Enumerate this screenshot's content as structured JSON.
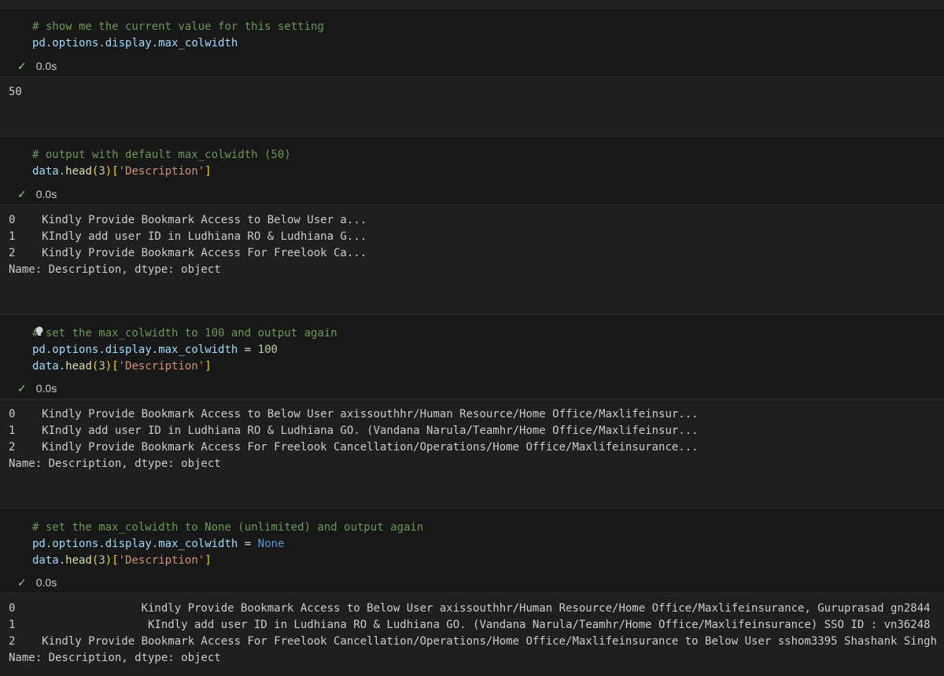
{
  "cells": [
    {
      "code": [
        [
          [
            "comment",
            "# show me the current value for this setting"
          ]
        ],
        [
          [
            "ident",
            "pd"
          ],
          [
            "punct",
            "."
          ],
          [
            "ident",
            "options"
          ],
          [
            "punct",
            "."
          ],
          [
            "ident",
            "display"
          ],
          [
            "punct",
            "."
          ],
          [
            "ident",
            "max_colwidth"
          ]
        ]
      ],
      "status": {
        "icon": "check-icon",
        "time": "0.0s"
      },
      "output": [
        "50"
      ]
    },
    {
      "code": [
        [
          [
            "comment",
            "# output with default max_colwidth (50)"
          ]
        ],
        [
          [
            "ident",
            "data"
          ],
          [
            "punct",
            "."
          ],
          [
            "func",
            "head"
          ],
          [
            "bracket",
            "("
          ],
          [
            "number",
            "3"
          ],
          [
            "bracket",
            ")"
          ],
          [
            "bracket",
            "["
          ],
          [
            "string",
            "'Description'"
          ],
          [
            "bracket",
            "]"
          ]
        ]
      ],
      "status": {
        "icon": "check-icon",
        "time": "0.0s"
      },
      "output": [
        "0    Kindly Provide Bookmark Access to Below User a...",
        "1    KIndly add user ID in Ludhiana RO & Ludhiana G...",
        "2    Kindly Provide Bookmark Access For Freelook Ca...",
        "Name: Description, dtype: object"
      ]
    },
    {
      "code": [
        [
          [
            "comment",
            "# set the max_colwidth to 100 and output again"
          ]
        ],
        [
          [
            "ident",
            "pd"
          ],
          [
            "punct",
            "."
          ],
          [
            "ident",
            "options"
          ],
          [
            "punct",
            "."
          ],
          [
            "ident",
            "display"
          ],
          [
            "punct",
            "."
          ],
          [
            "ident",
            "max_colwidth"
          ],
          [
            "op",
            " = "
          ],
          [
            "number",
            "100"
          ]
        ],
        [
          [
            "ident",
            "data"
          ],
          [
            "punct",
            "."
          ],
          [
            "func",
            "head"
          ],
          [
            "bracket",
            "("
          ],
          [
            "number",
            "3"
          ],
          [
            "bracket",
            ")"
          ],
          [
            "bracket",
            "["
          ],
          [
            "string",
            "'Description'"
          ],
          [
            "bracket",
            "]"
          ]
        ]
      ],
      "status": {
        "icon": "check-icon",
        "time": "0.0s"
      },
      "output": [
        "0    Kindly Provide Bookmark Access to Below User axissouthhr/Human Resource/Home Office/Maxlifeinsur...",
        "1    KIndly add user ID in Ludhiana RO & Ludhiana GO. (Vandana Narula/Teamhr/Home Office/Maxlifeinsur...",
        "2    Kindly Provide Bookmark Access For Freelook Cancellation/Operations/Home Office/Maxlifeinsurance...",
        "Name: Description, dtype: object"
      ]
    },
    {
      "code": [
        [
          [
            "comment",
            "# set the max_colwidth to None (unlimited) and output again"
          ]
        ],
        [
          [
            "ident",
            "pd"
          ],
          [
            "punct",
            "."
          ],
          [
            "ident",
            "options"
          ],
          [
            "punct",
            "."
          ],
          [
            "ident",
            "display"
          ],
          [
            "punct",
            "."
          ],
          [
            "ident",
            "max_colwidth"
          ],
          [
            "op",
            " = "
          ],
          [
            "const",
            "None"
          ]
        ],
        [
          [
            "ident",
            "data"
          ],
          [
            "punct",
            "."
          ],
          [
            "func",
            "head"
          ],
          [
            "bracket",
            "("
          ],
          [
            "number",
            "3"
          ],
          [
            "bracket",
            ")"
          ],
          [
            "bracket",
            "["
          ],
          [
            "string",
            "'Description'"
          ],
          [
            "bracket",
            "]"
          ]
        ]
      ],
      "status": {
        "icon": "check-icon",
        "time": "0.0s"
      },
      "output": [
        "0                   Kindly Provide Bookmark Access to Below User axissouthhr/Human Resource/Home Office/Maxlifeinsurance, Guruprasad gn2844",
        "1                    KIndly add user ID in Ludhiana RO & Ludhiana GO. (Vandana Narula/Teamhr/Home Office/Maxlifeinsurance) SSO ID : vn36248",
        "2    Kindly Provide Bookmark Access For Freelook Cancellation/Operations/Home Office/Maxlifeinsurance to Below User sshom3395 Shashank Singh",
        "Name: Description, dtype: object"
      ]
    }
  ],
  "colors": {
    "background": "#1f1f1f",
    "code_background": "#181818",
    "comment": "#6a9955",
    "identifier": "#9cdcfe",
    "function": "#dcdcaa",
    "string": "#ce9178",
    "number": "#b5cea8",
    "constant": "#569cd6",
    "success": "#89d185"
  }
}
